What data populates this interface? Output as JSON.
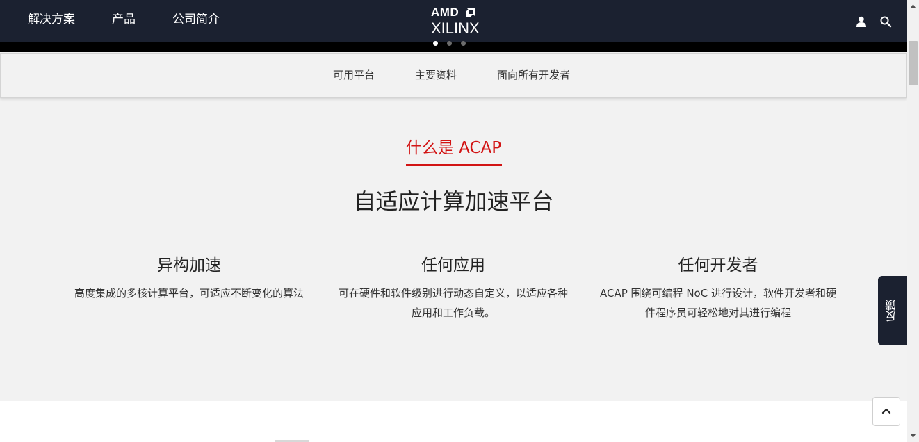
{
  "topnav": {
    "links": [
      "解决方案",
      "产品",
      "公司简介"
    ],
    "logo": {
      "line1": "AMD",
      "line2": "XILINX"
    },
    "icons": [
      "user-icon",
      "search-icon"
    ]
  },
  "carousel": {
    "dot_count": 3,
    "active_index": 0
  },
  "subnav": {
    "links": [
      "可用平台",
      "主要资料",
      "面向所有开发者"
    ]
  },
  "section": {
    "eyebrow": "什么是 ACAP",
    "heading": "自适应计算加速平台",
    "features": [
      {
        "title": "异构加速",
        "desc": "高度集成的多核计算平台，可适应不断变化的算法"
      },
      {
        "title": "任何应用",
        "desc": "可在硬件和软件级别进行动态自定义，以适应各种应用和工作负载。"
      },
      {
        "title": "任何开发者",
        "desc": "ACAP 围绕可编程 NoC 进行设计，软件开发者和硬件程序员可轻松地对其进行编程"
      }
    ]
  },
  "feedback": {
    "label": "反馈"
  },
  "back_to_top": {
    "icon": "chevron-up-icon"
  },
  "colors": {
    "nav_bg": "#1b2130",
    "accent_red": "#d21414",
    "page_bg": "#f2f2f2"
  }
}
